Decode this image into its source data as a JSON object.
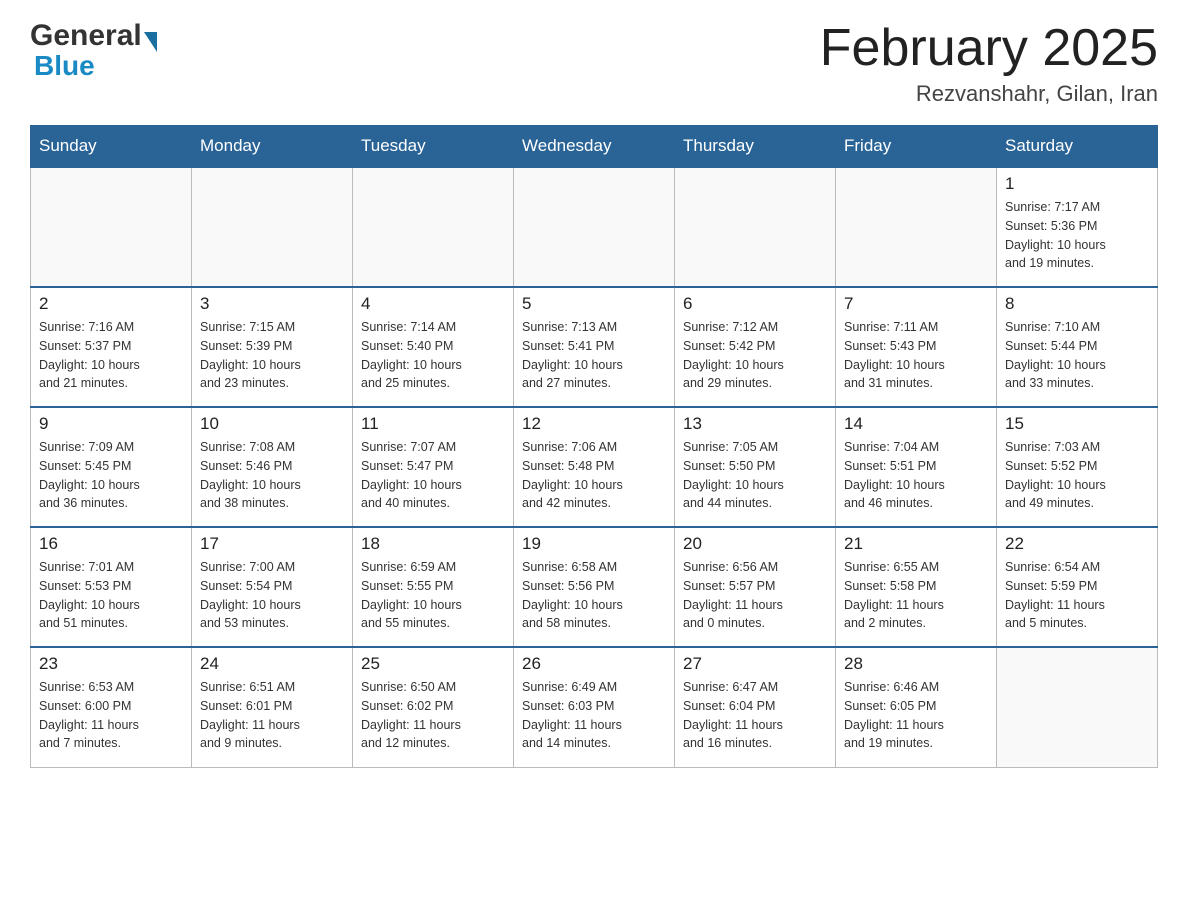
{
  "header": {
    "logo": {
      "general": "General",
      "blue": "Blue",
      "arrow": "▶"
    },
    "title": "February 2025",
    "subtitle": "Rezvanshahr, Gilan, Iran"
  },
  "weekdays": [
    "Sunday",
    "Monday",
    "Tuesday",
    "Wednesday",
    "Thursday",
    "Friday",
    "Saturday"
  ],
  "weeks": [
    [
      {
        "day": "",
        "info": ""
      },
      {
        "day": "",
        "info": ""
      },
      {
        "day": "",
        "info": ""
      },
      {
        "day": "",
        "info": ""
      },
      {
        "day": "",
        "info": ""
      },
      {
        "day": "",
        "info": ""
      },
      {
        "day": "1",
        "info": "Sunrise: 7:17 AM\nSunset: 5:36 PM\nDaylight: 10 hours\nand 19 minutes."
      }
    ],
    [
      {
        "day": "2",
        "info": "Sunrise: 7:16 AM\nSunset: 5:37 PM\nDaylight: 10 hours\nand 21 minutes."
      },
      {
        "day": "3",
        "info": "Sunrise: 7:15 AM\nSunset: 5:39 PM\nDaylight: 10 hours\nand 23 minutes."
      },
      {
        "day": "4",
        "info": "Sunrise: 7:14 AM\nSunset: 5:40 PM\nDaylight: 10 hours\nand 25 minutes."
      },
      {
        "day": "5",
        "info": "Sunrise: 7:13 AM\nSunset: 5:41 PM\nDaylight: 10 hours\nand 27 minutes."
      },
      {
        "day": "6",
        "info": "Sunrise: 7:12 AM\nSunset: 5:42 PM\nDaylight: 10 hours\nand 29 minutes."
      },
      {
        "day": "7",
        "info": "Sunrise: 7:11 AM\nSunset: 5:43 PM\nDaylight: 10 hours\nand 31 minutes."
      },
      {
        "day": "8",
        "info": "Sunrise: 7:10 AM\nSunset: 5:44 PM\nDaylight: 10 hours\nand 33 minutes."
      }
    ],
    [
      {
        "day": "9",
        "info": "Sunrise: 7:09 AM\nSunset: 5:45 PM\nDaylight: 10 hours\nand 36 minutes."
      },
      {
        "day": "10",
        "info": "Sunrise: 7:08 AM\nSunset: 5:46 PM\nDaylight: 10 hours\nand 38 minutes."
      },
      {
        "day": "11",
        "info": "Sunrise: 7:07 AM\nSunset: 5:47 PM\nDaylight: 10 hours\nand 40 minutes."
      },
      {
        "day": "12",
        "info": "Sunrise: 7:06 AM\nSunset: 5:48 PM\nDaylight: 10 hours\nand 42 minutes."
      },
      {
        "day": "13",
        "info": "Sunrise: 7:05 AM\nSunset: 5:50 PM\nDaylight: 10 hours\nand 44 minutes."
      },
      {
        "day": "14",
        "info": "Sunrise: 7:04 AM\nSunset: 5:51 PM\nDaylight: 10 hours\nand 46 minutes."
      },
      {
        "day": "15",
        "info": "Sunrise: 7:03 AM\nSunset: 5:52 PM\nDaylight: 10 hours\nand 49 minutes."
      }
    ],
    [
      {
        "day": "16",
        "info": "Sunrise: 7:01 AM\nSunset: 5:53 PM\nDaylight: 10 hours\nand 51 minutes."
      },
      {
        "day": "17",
        "info": "Sunrise: 7:00 AM\nSunset: 5:54 PM\nDaylight: 10 hours\nand 53 minutes."
      },
      {
        "day": "18",
        "info": "Sunrise: 6:59 AM\nSunset: 5:55 PM\nDaylight: 10 hours\nand 55 minutes."
      },
      {
        "day": "19",
        "info": "Sunrise: 6:58 AM\nSunset: 5:56 PM\nDaylight: 10 hours\nand 58 minutes."
      },
      {
        "day": "20",
        "info": "Sunrise: 6:56 AM\nSunset: 5:57 PM\nDaylight: 11 hours\nand 0 minutes."
      },
      {
        "day": "21",
        "info": "Sunrise: 6:55 AM\nSunset: 5:58 PM\nDaylight: 11 hours\nand 2 minutes."
      },
      {
        "day": "22",
        "info": "Sunrise: 6:54 AM\nSunset: 5:59 PM\nDaylight: 11 hours\nand 5 minutes."
      }
    ],
    [
      {
        "day": "23",
        "info": "Sunrise: 6:53 AM\nSunset: 6:00 PM\nDaylight: 11 hours\nand 7 minutes."
      },
      {
        "day": "24",
        "info": "Sunrise: 6:51 AM\nSunset: 6:01 PM\nDaylight: 11 hours\nand 9 minutes."
      },
      {
        "day": "25",
        "info": "Sunrise: 6:50 AM\nSunset: 6:02 PM\nDaylight: 11 hours\nand 12 minutes."
      },
      {
        "day": "26",
        "info": "Sunrise: 6:49 AM\nSunset: 6:03 PM\nDaylight: 11 hours\nand 14 minutes."
      },
      {
        "day": "27",
        "info": "Sunrise: 6:47 AM\nSunset: 6:04 PM\nDaylight: 11 hours\nand 16 minutes."
      },
      {
        "day": "28",
        "info": "Sunrise: 6:46 AM\nSunset: 6:05 PM\nDaylight: 11 hours\nand 19 minutes."
      },
      {
        "day": "",
        "info": ""
      }
    ]
  ]
}
